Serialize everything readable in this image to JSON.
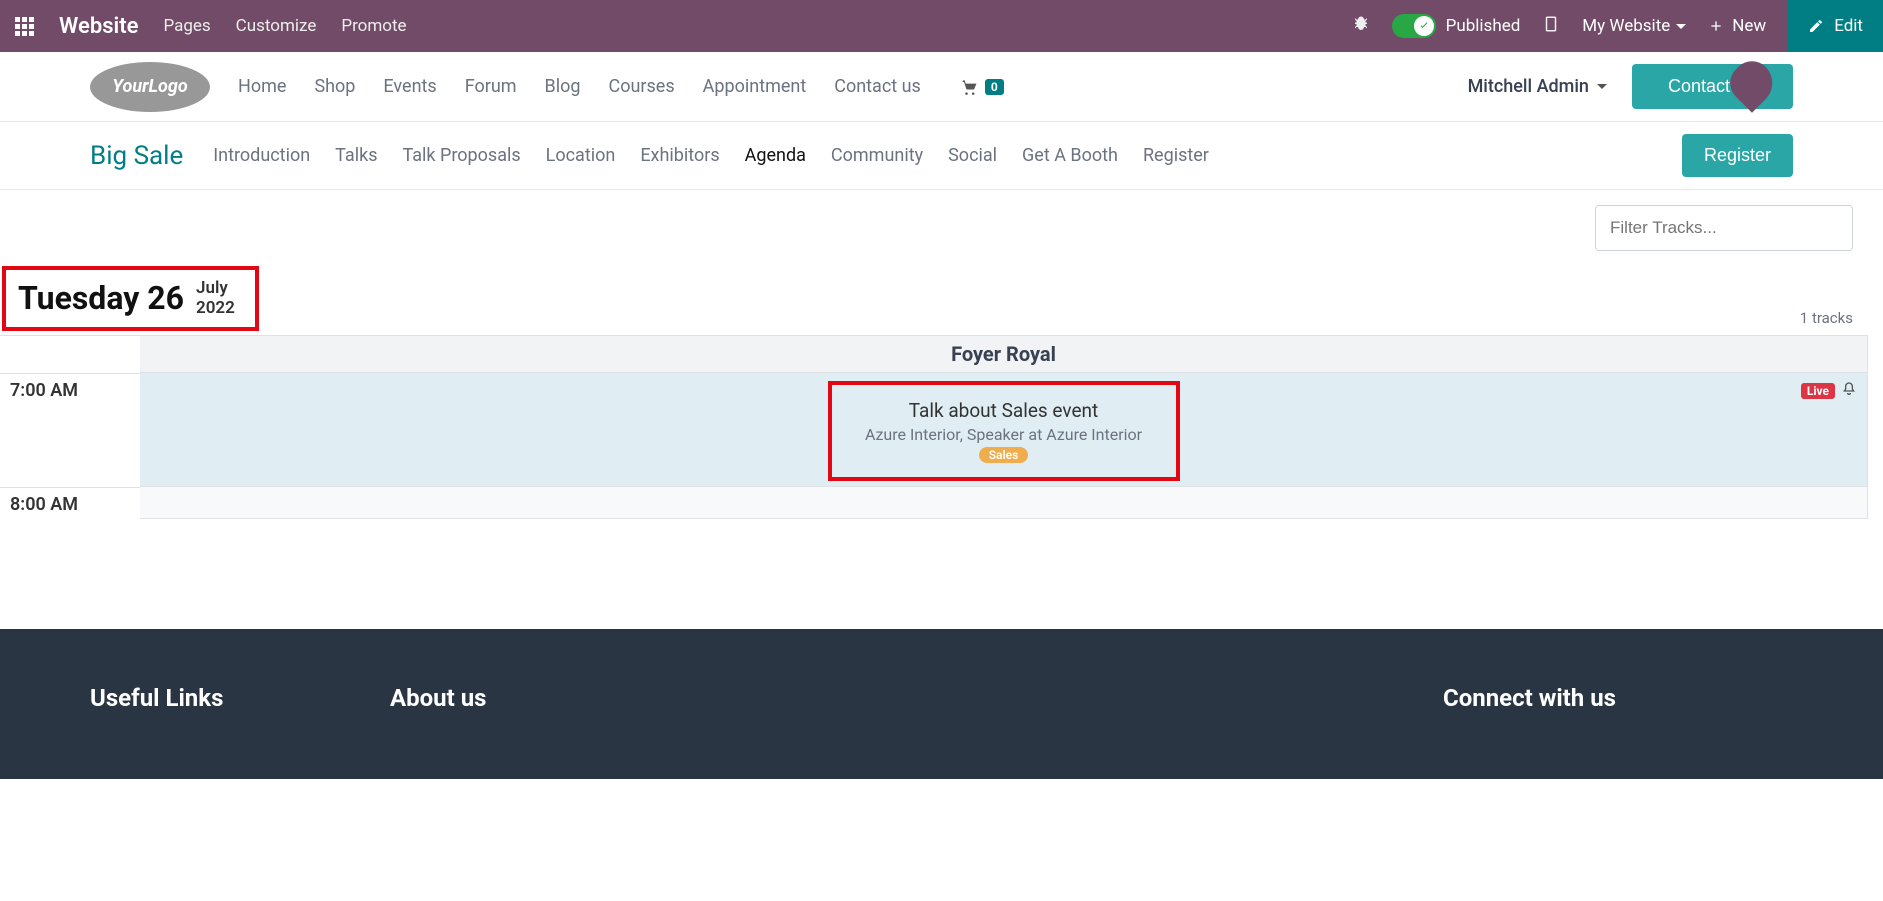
{
  "topbar": {
    "brand": "Website",
    "links": {
      "pages": "Pages",
      "customize": "Customize",
      "promote": "Promote"
    },
    "published": "Published",
    "my_website": "My Website",
    "new": "New",
    "edit": "Edit"
  },
  "sitenav": {
    "logo_text": "YourLogo",
    "items": {
      "home": "Home",
      "shop": "Shop",
      "events": "Events",
      "forum": "Forum",
      "blog": "Blog",
      "courses": "Courses",
      "appointment": "Appointment",
      "contact": "Contact us"
    },
    "cart_count": "0",
    "user": "Mitchell Admin",
    "contact_btn": "Contact Us"
  },
  "eventnav": {
    "title": "Big Sale",
    "items": {
      "intro": "Introduction",
      "talks": "Talks",
      "proposals": "Talk Proposals",
      "location": "Location",
      "exhibitors": "Exhibitors",
      "agenda": "Agenda",
      "community": "Community",
      "social": "Social",
      "booth": "Get A Booth",
      "register": "Register"
    },
    "register_btn": "Register"
  },
  "filter": {
    "placeholder": "Filter Tracks..."
  },
  "agenda": {
    "day": "Tuesday 26",
    "month": "July",
    "year": "2022",
    "tracks_count": "1 tracks",
    "track_header": "Foyer Royal",
    "times": {
      "t1": "7:00 AM",
      "t2": "8:00 AM"
    },
    "talk": {
      "title": "Talk about Sales event",
      "speaker": "Azure Interior, Speaker at Azure Interior",
      "tag": "Sales",
      "live": "Live"
    }
  },
  "footer": {
    "useful": "Useful Links",
    "about": "About us",
    "connect": "Connect with us"
  }
}
